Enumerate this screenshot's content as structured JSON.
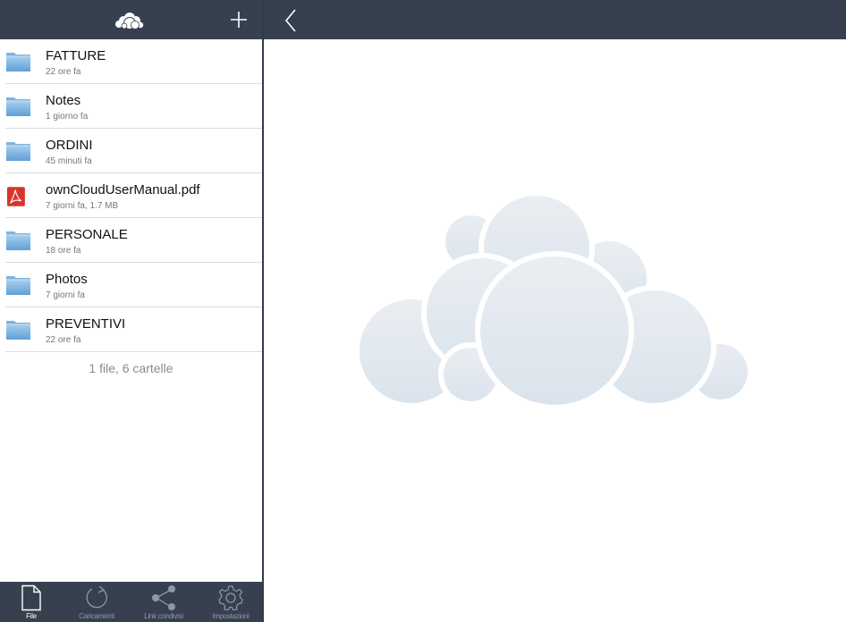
{
  "sidebar": {
    "logo_icon": "owncloud-logo-icon",
    "add_icon": "plus-icon",
    "files": [
      {
        "name": "FATTURE",
        "meta": "22 ore fa",
        "icon": "folder-icon"
      },
      {
        "name": "Notes",
        "meta": "1 giorno fa",
        "icon": "folder-icon"
      },
      {
        "name": "ORDINI",
        "meta": "45 minuti fa",
        "icon": "folder-icon"
      },
      {
        "name": "ownCloudUserManual.pdf",
        "meta": "7 giorni fa, 1.7 MB",
        "icon": "pdf-icon"
      },
      {
        "name": "PERSONALE",
        "meta": "18 ore fa",
        "icon": "folder-icon"
      },
      {
        "name": "Photos",
        "meta": "7 giorni fa",
        "icon": "folder-icon"
      },
      {
        "name": "PREVENTIVI",
        "meta": "22 ore fa",
        "icon": "folder-icon"
      }
    ],
    "summary": "1 file, 6 cartelle"
  },
  "tabs": [
    {
      "label": "File",
      "icon": "file-icon",
      "active": true
    },
    {
      "label": "Caricamenti",
      "icon": "refresh-icon",
      "active": false
    },
    {
      "label": "Link condivisi",
      "icon": "share-icon",
      "active": false
    },
    {
      "label": "Impostazioni",
      "icon": "gear-icon",
      "active": false
    }
  ],
  "detail": {
    "back_icon": "chevron-left-icon",
    "placeholder_icon": "owncloud-cloud-icon"
  },
  "colors": {
    "bar": "#36404f",
    "divider": "#2f3a4a",
    "cloud": "#e3e9ef",
    "folder_top": "#a9cfee",
    "folder_bottom": "#5f9fd6",
    "pdf_red": "#d9342b"
  }
}
